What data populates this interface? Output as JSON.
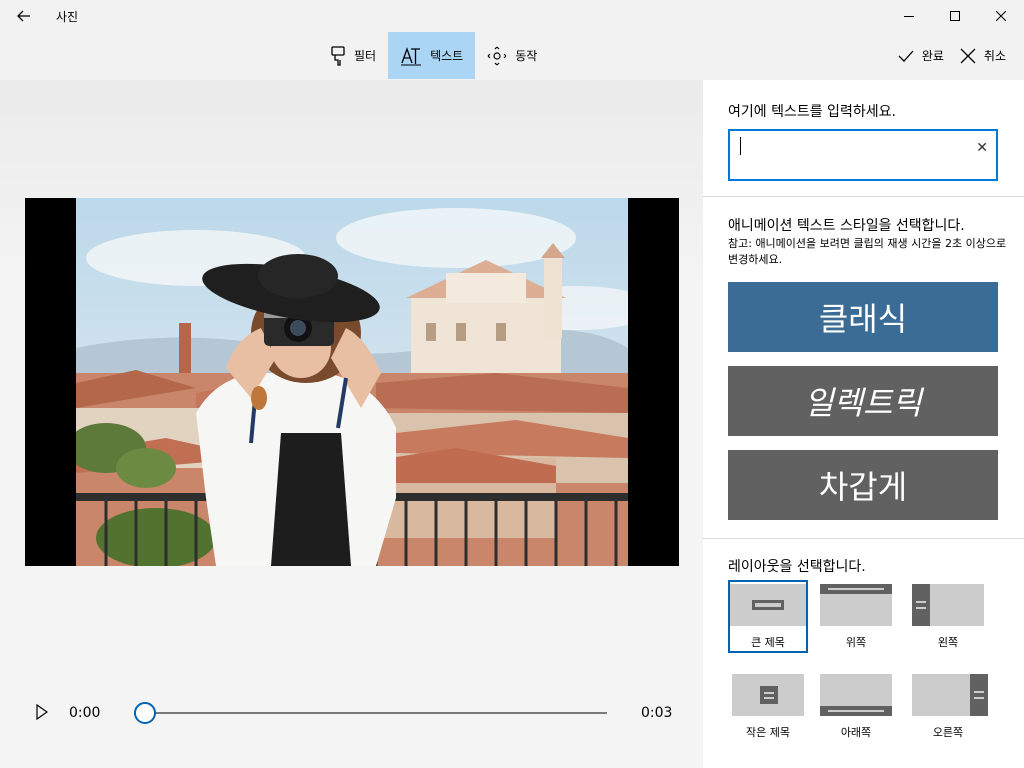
{
  "app": {
    "title": "사진"
  },
  "toolbar": {
    "filter_label": "필터",
    "text_label": "텍스트",
    "motion_label": "동작",
    "done_label": "완료",
    "cancel_label": "취소"
  },
  "player": {
    "current_time": "0:00",
    "total_time": "0:03",
    "progress": 0.0
  },
  "panel": {
    "input_title": "여기에 텍스트를 입력하세요.",
    "input_value": "",
    "style_title": "애니메이션 텍스트 스타일을 선택합니다.",
    "style_note": "참고: 애니메이션을 보려면 클립의 재생 시간을 2초 이상으로 변경하세요.",
    "styles": [
      "클래식",
      "일렉트릭",
      "차갑게"
    ],
    "layout_title": "레이아웃을 선택합니다.",
    "layouts": [
      "큰 제목",
      "위쪽",
      "왼쪽",
      "작은 제목",
      "아래쪽",
      "오른쪽"
    ],
    "selected_layout": "큰 제목"
  },
  "colors": {
    "accent": "#0078d7",
    "classic_bg": "#3b6c96",
    "style_bg": "#616161",
    "active_tool": "#aad5f5"
  }
}
